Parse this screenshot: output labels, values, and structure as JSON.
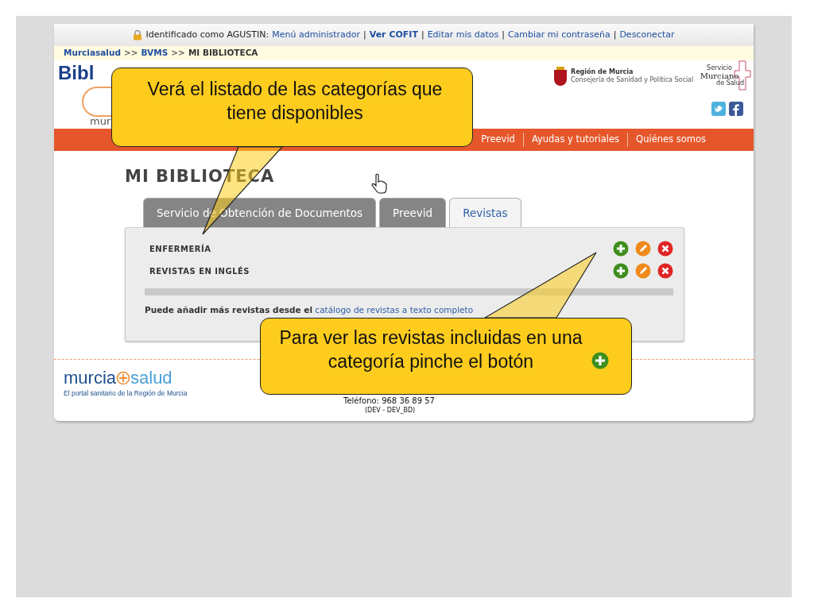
{
  "top_bar": {
    "prefix": "Identificado como AGUSTIN:",
    "separator": "|",
    "links": [
      {
        "label": "Menú administrador",
        "bold": false
      },
      {
        "label": "Ver COFIT",
        "bold": true
      },
      {
        "label": "Editar mis datos",
        "bold": false
      },
      {
        "label": "Cambiar mi contraseña",
        "bold": false
      },
      {
        "label": "Desconectar",
        "bold": false
      }
    ]
  },
  "breadcrumb": [
    {
      "text": "Murciasalud",
      "kind": "link"
    },
    {
      "text": ">>",
      "kind": "separator"
    },
    {
      "text": "BVMS",
      "kind": "link"
    },
    {
      "text": ">>",
      "kind": "separator"
    },
    {
      "text": "MI BIBLIOTECA",
      "kind": "current"
    }
  ],
  "header": {
    "logo_top": "Bibl",
    "logo_bottom": "mur",
    "region_name": "Región de Murcia",
    "region_sub": "Consejería de Sanidad y Política Social",
    "service_small": "Servicio",
    "service_name": "Murciano",
    "service_sub": "de Salud"
  },
  "nav": [
    "Preevid",
    "Ayudas y tutoriales",
    "Quiénes somos"
  ],
  "page_title": "MI BIBLIOTECA",
  "tabs": [
    {
      "label": "Servicio de Obtención de Documentos",
      "selected": false
    },
    {
      "label": "Preevid",
      "selected": false
    },
    {
      "label": "Revistas",
      "selected": true
    }
  ],
  "categories": [
    {
      "name": "ENFERMERÍA"
    },
    {
      "name": "REVISTAS EN INGLÉS"
    }
  ],
  "info": {
    "text": "**Puede añadir más revistas desde el**",
    "link": "catálogo de revistas a texto completo"
  },
  "footer": {
    "logo_left": "murcia",
    "logo_right": "salud",
    "tagline": "El portal sanitario de la Región de Murcia",
    "phone": "Teléfono: 968 36 89 57",
    "env": "(DEV - DEV_BD)"
  },
  "callouts": [
    {
      "text": "Verá el listado de las categorías que tiene disponibles",
      "icon": false
    },
    {
      "text": "Para ver las revistas incluidas en una categoría pinche el botón",
      "icon": true
    }
  ]
}
